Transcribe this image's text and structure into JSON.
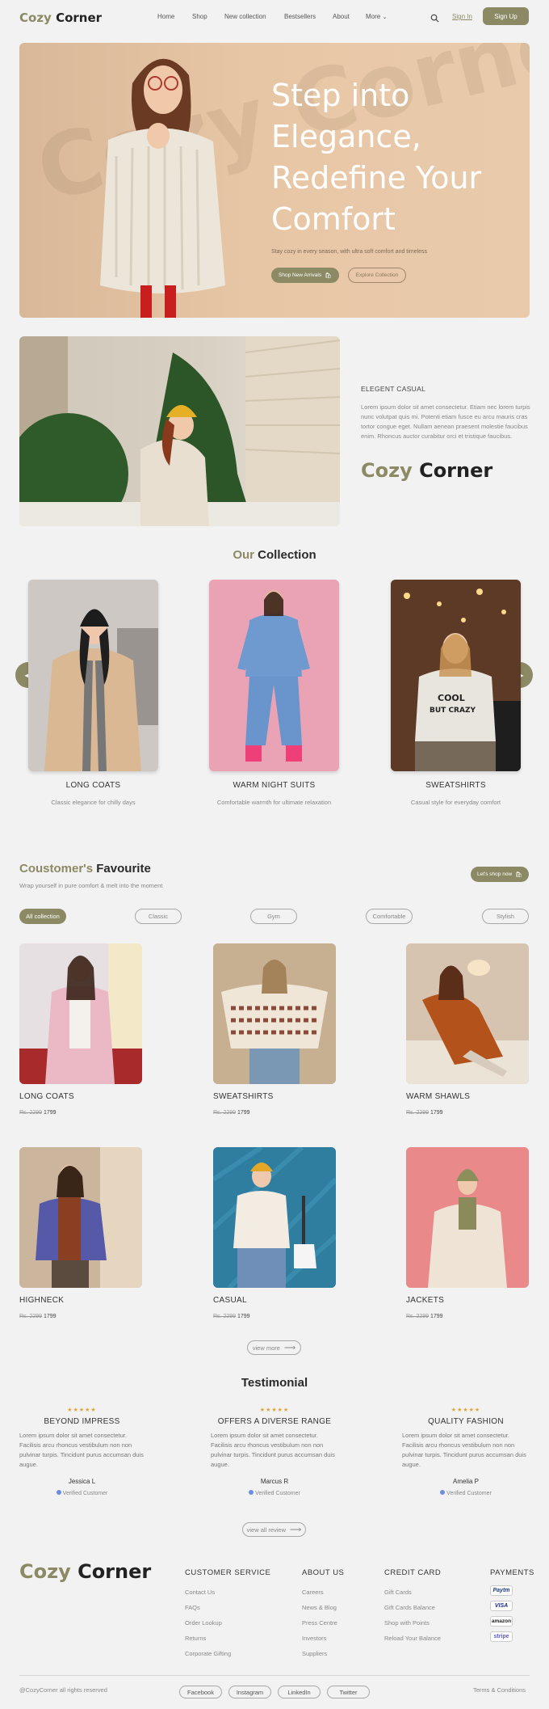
{
  "header": {
    "logo_first": "Cozy",
    "logo_second": "Corner",
    "nav": [
      "Home",
      "Shop",
      "New collection",
      "Bestsellers",
      "About",
      "More"
    ],
    "signin": "Sign In",
    "signup": "Sign Up"
  },
  "hero": {
    "watermark": "Cozy Corner",
    "title": "Step into Elegance, Redefine Your Comfort",
    "subtitle": "Stay cozy in every season, with ultra soft comfort and timeless",
    "btn_primary": "Shop New Arrivals",
    "btn_secondary": "Explore Collection"
  },
  "about": {
    "label": "ELEGENT CASUAL",
    "text": "Lorem ipsum dolor sit amet consectetur. Etiam nec lorem turpis nunc volutpat quis mi. Potenti etiam fusce eu arcu mauris cras tortor congue eget. Nullam aenean praesent molestie faucibus enim. Rhoncus auctor curabitur orci et tristique faucibus.",
    "brand_first": "Cozy",
    "brand_second": "Corner"
  },
  "collection": {
    "heading_first": "Our",
    "heading_second": "Collection",
    "items": [
      {
        "title": "LONG COATS",
        "subtitle": "Classic elegance for chilly days"
      },
      {
        "title": "WARM NIGHT SUITS",
        "subtitle": "Comfortable warmth for ultimate relaxation"
      },
      {
        "title": "SWEATSHIRTS",
        "subtitle": "Casual style for everyday comfort"
      }
    ]
  },
  "favourite": {
    "heading_first": "Coustomer's",
    "heading_second": "Favourite",
    "subtitle": "Wrap yourself in pure comfort & melt into the moment",
    "shop_button": "Let's shop now",
    "filters": [
      "All collection",
      "Classic",
      "Gym",
      "Comfortable",
      "Stylish"
    ],
    "products": [
      {
        "title": "LONG COATS",
        "old_price": "Rs. 2299",
        "price": "1799"
      },
      {
        "title": "SWEATSHIRTS",
        "old_price": "Rs. 2299",
        "price": "1799"
      },
      {
        "title": "WARM SHAWLS",
        "old_price": "Rs. 2299",
        "price": "1799"
      },
      {
        "title": "HIGHNECK",
        "old_price": "Rs. 2299",
        "price": "1799"
      },
      {
        "title": "CASUAL",
        "old_price": "Rs. 2299",
        "price": "1799"
      },
      {
        "title": "JACKETS",
        "old_price": "Rs. 2299",
        "price": "1799"
      }
    ],
    "view_more": "view more"
  },
  "testimonial": {
    "heading": "Testimonial",
    "stars": "★★★★★",
    "items": [
      {
        "title": "BEYOND IMPRESS",
        "text": "Lorem ipsum dolor sit amet consectetur. Facilisis arcu rhoncus vestibulum non non pulvinar turpis. Tincidunt purus accumsan duis augue.",
        "name": "Jessica L",
        "badge": "Verified Customer"
      },
      {
        "title": "OFFERS A DIVERSE RANGE",
        "text": "Lorem ipsum dolor sit amet consectetur. Facilisis arcu rhoncus vestibulum non non pulvinar turpis. Tincidunt purus accumsan duis augue.",
        "name": "Marcus R",
        "badge": "Verified Customer"
      },
      {
        "title": "QUALITY FASHION",
        "text": "Lorem ipsum dolor sit amet consectetur. Facilisis arcu rhoncus vestibulum non non pulvinar turpis. Tincidunt purus accumsan duis augue.",
        "name": "Amelia P",
        "badge": "Verified Customer"
      }
    ],
    "view_all": "view all review"
  },
  "footer": {
    "logo_first": "Cozy",
    "logo_second": "Corner",
    "columns": [
      {
        "heading": "CUSTOMER SERVICE",
        "links": [
          "Contact Us",
          "FAQs",
          "Order Lookup",
          "Returns",
          "Corporate Gifting"
        ]
      },
      {
        "heading": "ABOUT US",
        "links": [
          "Careers",
          "News & Blog",
          "Press Centre",
          "Investors",
          "Suppliers"
        ]
      },
      {
        "heading": "CREDIT CARD",
        "links": [
          "Gift Cards",
          "Gift Cards Balance",
          "Shop with Points",
          "Reload Your Balance"
        ]
      }
    ],
    "payments_heading": "PAYMENTS",
    "payments": [
      "Paytm",
      "VISA",
      "amazon",
      "stripe"
    ],
    "copyright": "@CozyCorner all rights reserved",
    "socials": [
      "Facebook",
      "Instagram",
      "LinkedIn",
      "Twitter"
    ],
    "terms": "Terms & Conditions"
  },
  "colors": {
    "accent": "#8c8a64",
    "background": "#f2f2f2",
    "hero": "#e7c6a5"
  }
}
